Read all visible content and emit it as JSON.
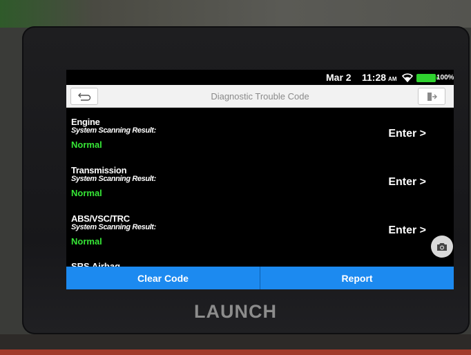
{
  "status_bar": {
    "date": "Mar 2",
    "time": "11:28",
    "ampm": "AM",
    "battery": "100%"
  },
  "header": {
    "title": "Diagnostic Trouble Code",
    "icons": [
      "back-arrow-icon",
      "exit-icon"
    ]
  },
  "systems": [
    {
      "name": "Engine",
      "label": "System Scanning Result:",
      "status": "Normal",
      "action": "Enter >"
    },
    {
      "name": "Transmission",
      "label": "System Scanning Result:",
      "status": "Normal",
      "action": "Enter >"
    },
    {
      "name": "ABS/VSC/TRC",
      "label": "System Scanning Result:",
      "status": "Normal",
      "action": "Enter >"
    }
  ],
  "partial_item": "SRS Airbag",
  "footer": {
    "clear_code": "Clear Code",
    "report": "Report"
  },
  "device": {
    "brand": "LAUNCH"
  },
  "colors": {
    "status_normal": "#36e636",
    "button_blue": "#1c8af0",
    "battery": "#2fd22f"
  }
}
